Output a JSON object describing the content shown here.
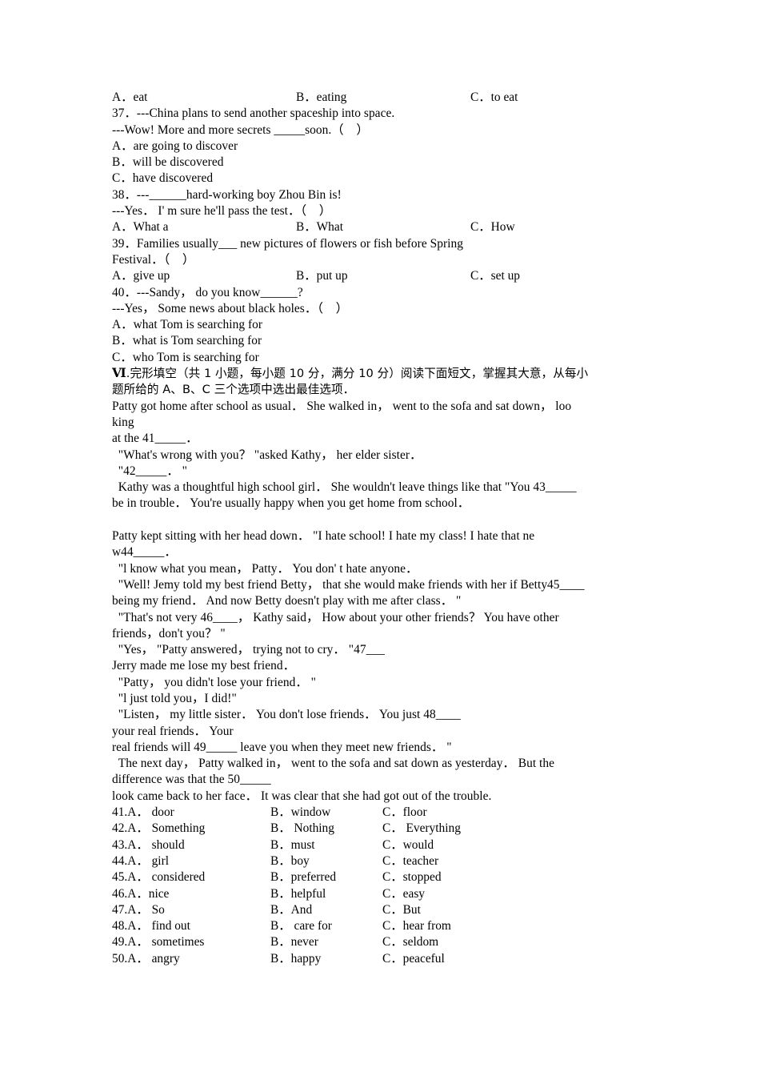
{
  "document": {
    "type": "exam-paper",
    "language": "zh-en",
    "background_color": "#ffffff",
    "text_color": "#000000"
  },
  "grammar_questions": {
    "q36_choices": {
      "a": "A．eat",
      "b": "B．eating",
      "c": "C．to eat"
    },
    "q37": {
      "stem": "37．---China plans to send another spaceship into space.",
      "stem2": "---Wow! More and more secrets _____soon.（    ）",
      "a": "A．are going to discover",
      "b": "B．will be discovered",
      "c": "C．have discovered"
    },
    "q38": {
      "stem": "38．---______hard-working boy Zhou Bin is!",
      "stem2": "---Yes． I' m sure he'll pass the test．（    ）",
      "a": "A．What a",
      "b": "B．What",
      "c": "C．How"
    },
    "q39": {
      "stem": "39．Families usually___ new pictures of flowers or fish before Spring",
      "stem2": "Festival．（    ）",
      "a": "A．give up",
      "b": "B．put up",
      "c": "C．set up"
    },
    "q40": {
      "stem": "40．---Sandy， do you know______?",
      "stem2": "---Yes， Some news about black holes．（    ）",
      "a": "A．what Tom is searching for",
      "b": "B．what is Tom searching for",
      "c": "C．who Tom is searching for"
    }
  },
  "section_vi": {
    "number": "Ⅵ",
    "heading_line1": ".完形填空（共 1 小题，每小题 10 分，满分 10 分）阅读下面短文，掌握其大意，从每小",
    "heading_line2": "题所给的 A、B、C 三个选项中选出最佳选项．",
    "passage": [
      "Patty got home after school as usual． She walked in， went to the sofa and sat down， loo",
      "king",
      "at the 41_____．",
      "  \"What's wrong with you？ \"asked Kathy， her elder sister．",
      "  \"42_____． \"",
      "  Kathy was a thoughtful high school girl． She wouldn't leave things like that \"You 43_____",
      "be in trouble． You're usually happy when you get home from school．",
      "",
      "Patty kept sitting with her head down． \"I hate school! I hate my class! I hate that ne",
      "w44_____．",
      "  \"l know what you mean， Patty． You don' t hate anyone．",
      "  \"Well! Jemy told my best friend Betty， that she would make friends with her if Betty45____",
      "being my friend． And now Betty doesn't play with me after class． \"",
      "  \"That's not very 46____， Kathy said， How about your other friends？ You have other",
      "friends，don't you？ \"",
      "  \"Yes， \"Patty answered， trying not to cry． \"47___",
      "Jerry made me lose my best friend．",
      "  \"Patty， you didn't lose your friend． \"",
      "  \"l just told you，I did!\"",
      "  \"Listen， my little sister． You don't lose friends． You just 48____",
      "your real friends． Your",
      "real friends will 49_____ leave you when they meet new friends． \"",
      "  The next day， Patty walked in， went to the sofa and sat down as yesterday． But the",
      "difference was that the 50_____",
      "look came back to her face． It was clear that she had got out of the trouble."
    ],
    "answer_options": [
      {
        "a": "41.A． door",
        "b": "B．window",
        "c": "C．floor"
      },
      {
        "a": "42.A． Something",
        "b": "B． Nothing",
        "c": "C． Everything"
      },
      {
        "a": "43.A． should",
        "b": "B．must",
        "c": "C．would"
      },
      {
        "a": "44.A． girl",
        "b": "B．boy",
        "c": "C．teacher"
      },
      {
        "a": "45.A． considered",
        "b": "B．preferred",
        "c": "C．stopped"
      },
      {
        "a": "46.A．nice",
        "b": "B．helpful",
        "c": "C．easy"
      },
      {
        "a": "47.A． So",
        "b": "B．And",
        "c": "C．But"
      },
      {
        "a": "48.A． find out",
        "b": "B． care for",
        "c": "C．hear from"
      },
      {
        "a": "49.A． sometimes",
        "b": "B．never",
        "c": "C．seldom"
      },
      {
        "a": "50.A． angry",
        "b": "B．happy",
        "c": "C．peaceful"
      }
    ]
  }
}
